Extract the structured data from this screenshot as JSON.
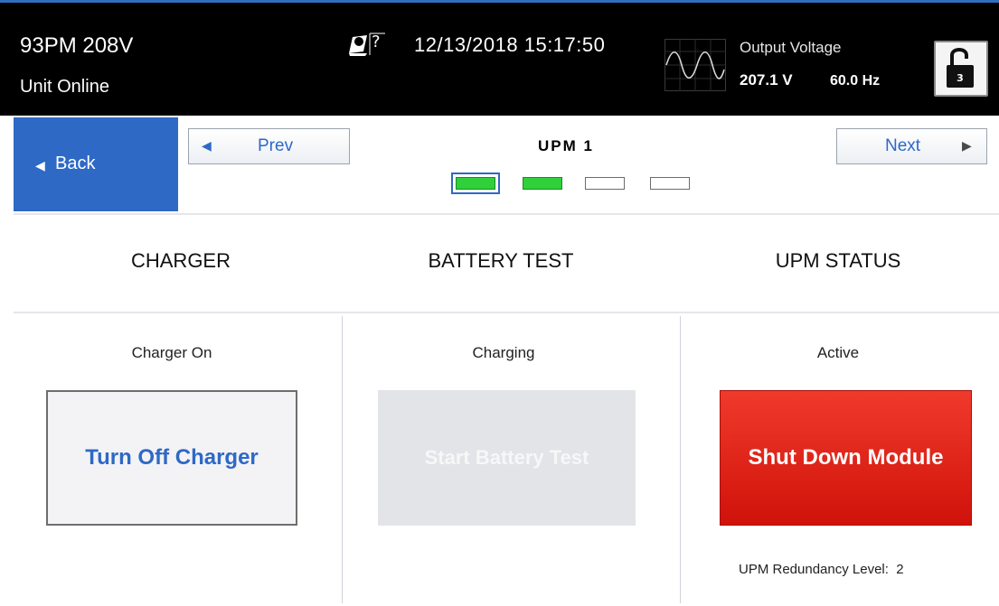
{
  "header": {
    "model": "93PM 208V",
    "status": "Unit Online",
    "datetime": "12/13/2018 15:17:50",
    "output_voltage_label": "Output Voltage",
    "output_voltage": "207.1 V",
    "output_frequency": "60.0 Hz",
    "lock_level": "3",
    "icons": {
      "help": "help-icon",
      "waveform": "waveform-icon",
      "lock": "unlock-icon"
    }
  },
  "nav": {
    "back_label": "Back",
    "prev_label": "Prev",
    "next_label": "Next",
    "title": "UPM 1",
    "indicators": [
      {
        "state": "selected-active"
      },
      {
        "state": "active"
      },
      {
        "state": "inactive"
      },
      {
        "state": "inactive"
      }
    ]
  },
  "sections": {
    "charger": {
      "header": "CHARGER",
      "status": "Charger On",
      "button_label": "Turn Off Charger"
    },
    "battery_test": {
      "header": "BATTERY TEST",
      "status": "Charging",
      "button_label": "Start Battery Test",
      "button_enabled": false
    },
    "upm_status": {
      "header": "UPM STATUS",
      "status": "Active",
      "button_label": "Shut Down Module",
      "redundancy_label": "UPM Redundancy Level:",
      "redundancy_value": "2"
    }
  },
  "colors": {
    "accent_blue": "#2e69c6",
    "indicator_green": "#2fd03a",
    "danger_red": "#e02418",
    "header_bg": "#000000"
  }
}
